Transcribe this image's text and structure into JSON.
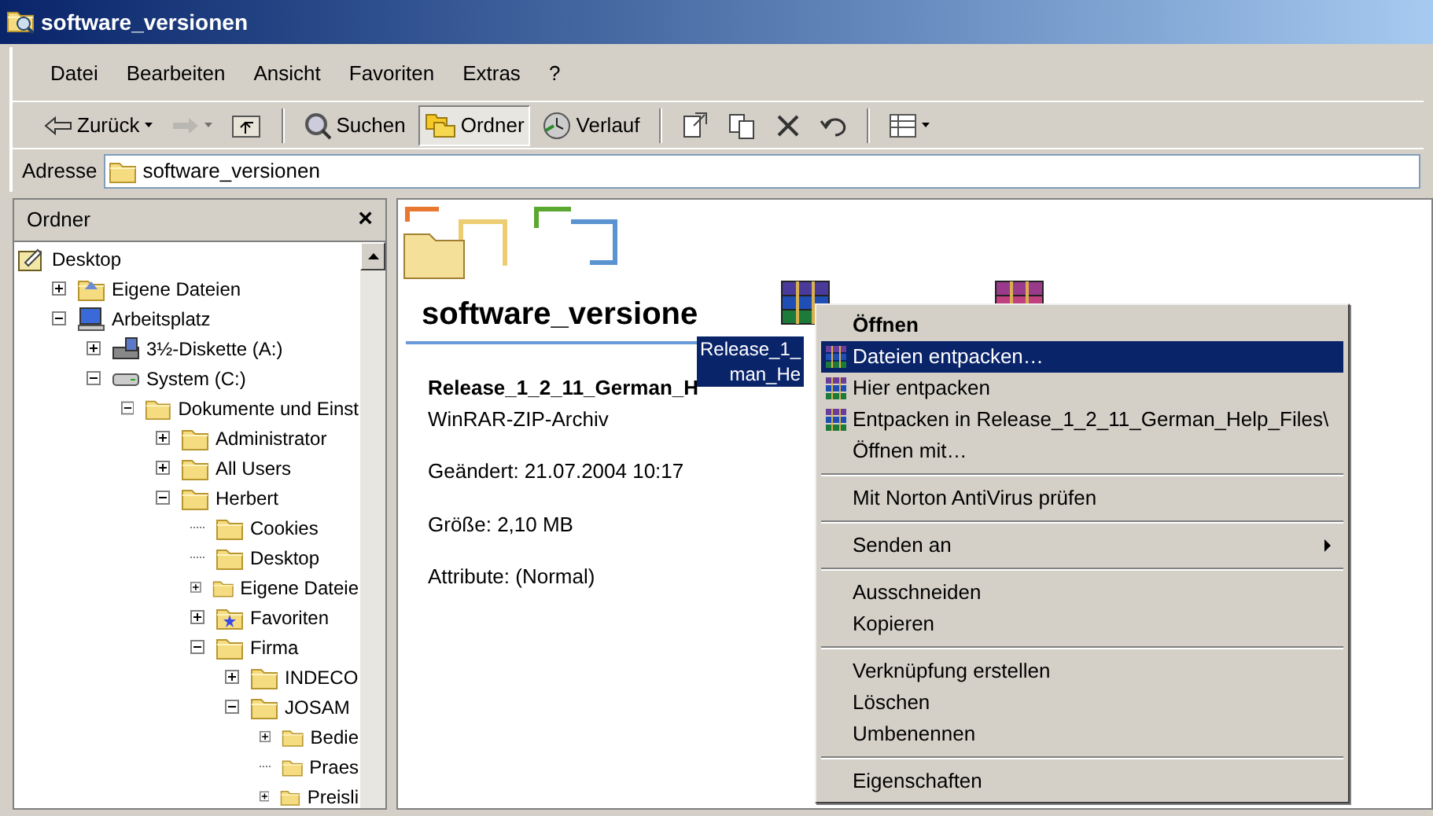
{
  "window": {
    "title": "software_versionen"
  },
  "menu_bar": [
    "Datei",
    "Bearbeiten",
    "Ansicht",
    "Favoriten",
    "Extras",
    "?"
  ],
  "toolbar": [
    {
      "kind": "back",
      "label": "Zurück",
      "disabled": false,
      "selected": false
    },
    {
      "kind": "forward",
      "disabled": true,
      "selected": false
    },
    {
      "kind": "up",
      "disabled": false,
      "selected": false
    },
    {
      "kind": "separator"
    },
    {
      "kind": "search",
      "label": "Suchen",
      "disabled": false,
      "selected": false
    },
    {
      "kind": "folders",
      "label": "Ordner",
      "disabled": false,
      "selected": true
    },
    {
      "kind": "history",
      "label": "Verlauf",
      "disabled": false,
      "selected": false
    },
    {
      "kind": "separator"
    },
    {
      "kind": "move",
      "disabled": false,
      "selected": false
    },
    {
      "kind": "copy",
      "disabled": false,
      "selected": false
    },
    {
      "kind": "delete",
      "disabled": false,
      "selected": false
    },
    {
      "kind": "undo",
      "disabled": false,
      "selected": false
    },
    {
      "kind": "separator"
    },
    {
      "kind": "views",
      "disabled": false,
      "selected": false
    }
  ],
  "address_bar": {
    "label": "Adresse",
    "value": "software_versionen"
  },
  "folders_pane": {
    "title": "Ordner",
    "close": "×",
    "tree": [
      {
        "label": "Desktop",
        "kind": "desktop",
        "children": [
          {
            "label": "Eigene Dateien",
            "kind": "documents",
            "expanded": false
          },
          {
            "label": "Arbeitsplatz",
            "kind": "computer",
            "expanded": true,
            "children": [
              {
                "label": "3½-Diskette (A:)",
                "kind": "floppy",
                "expanded": false
              },
              {
                "label": "System (C:)",
                "kind": "drive",
                "expanded": true,
                "children": [
                  {
                    "label": "Dokumente und Einst",
                    "kind": "folder",
                    "expanded": true,
                    "children": [
                      {
                        "label": "Administrator",
                        "kind": "folder",
                        "expanded": false
                      },
                      {
                        "label": "All Users",
                        "kind": "folder",
                        "expanded": false
                      },
                      {
                        "label": "Herbert",
                        "kind": "folder",
                        "expanded": true,
                        "children": [
                          {
                            "label": "Cookies",
                            "kind": "folder"
                          },
                          {
                            "label": "Desktop",
                            "kind": "folder"
                          },
                          {
                            "label": "Eigene Dateie",
                            "kind": "folder",
                            "expanded": false
                          },
                          {
                            "label": "Favoriten",
                            "kind": "favorites",
                            "expanded": false
                          },
                          {
                            "label": "Firma",
                            "kind": "folder",
                            "expanded": true,
                            "children": [
                              {
                                "label": "INDECO",
                                "kind": "folder",
                                "expanded": false
                              },
                              {
                                "label": "JOSAM",
                                "kind": "folder",
                                "expanded": true,
                                "children": [
                                  {
                                    "label": "Bedie",
                                    "kind": "folder",
                                    "expanded": false
                                  },
                                  {
                                    "label": "Praes",
                                    "kind": "folder"
                                  },
                                  {
                                    "label": "Preisli",
                                    "kind": "folder",
                                    "expanded": false
                                  }
                                ]
                              }
                            ]
                          }
                        ]
                      }
                    ]
                  }
                ]
              }
            ]
          }
        ]
      }
    ]
  },
  "details": {
    "folder_title": "software_versione",
    "file_name": "Release_1_2_11_German_H",
    "file_type": "WinRAR-ZIP-Archiv",
    "lines": [
      "Geändert: 21.07.2004 10:17",
      "Größe: 2,10 MB",
      "Attribute: (Normal)"
    ]
  },
  "files": [
    {
      "label_lines": [
        "Release_1_",
        "man_He"
      ],
      "selected": true
    },
    {
      "selected": false
    }
  ],
  "context_menu": [
    {
      "kind": "item",
      "label": "Öffnen",
      "default": true,
      "icon": false,
      "selected": false
    },
    {
      "kind": "item",
      "label": "Dateien entpacken…",
      "default": false,
      "icon": true,
      "selected": true
    },
    {
      "kind": "item",
      "label": "Hier entpacken",
      "default": false,
      "icon": true,
      "selected": false
    },
    {
      "kind": "item",
      "label": "Entpacken in Release_1_2_11_German_Help_Files\\",
      "default": false,
      "icon": true,
      "selected": false
    },
    {
      "kind": "item",
      "label": "Öffnen mit…",
      "default": false,
      "icon": false,
      "selected": false
    },
    {
      "kind": "separator"
    },
    {
      "kind": "item",
      "label": "Mit Norton AntiVirus prüfen",
      "default": false,
      "icon": false,
      "selected": false
    },
    {
      "kind": "separator"
    },
    {
      "kind": "submenu",
      "label": "Senden an",
      "default": false,
      "icon": false,
      "selected": false
    },
    {
      "kind": "separator"
    },
    {
      "kind": "item",
      "label": "Ausschneiden",
      "default": false,
      "icon": false,
      "selected": false
    },
    {
      "kind": "item",
      "label": "Kopieren",
      "default": false,
      "icon": false,
      "selected": false
    },
    {
      "kind": "separator"
    },
    {
      "kind": "item",
      "label": "Verknüpfung erstellen",
      "default": false,
      "icon": false,
      "selected": false
    },
    {
      "kind": "item",
      "label": "Löschen",
      "default": false,
      "icon": false,
      "selected": false
    },
    {
      "kind": "item",
      "label": "Umbenennen",
      "default": false,
      "icon": false,
      "selected": false
    },
    {
      "kind": "separator"
    },
    {
      "kind": "item",
      "label": "Eigenschaften",
      "default": false,
      "icon": false,
      "selected": false
    }
  ]
}
